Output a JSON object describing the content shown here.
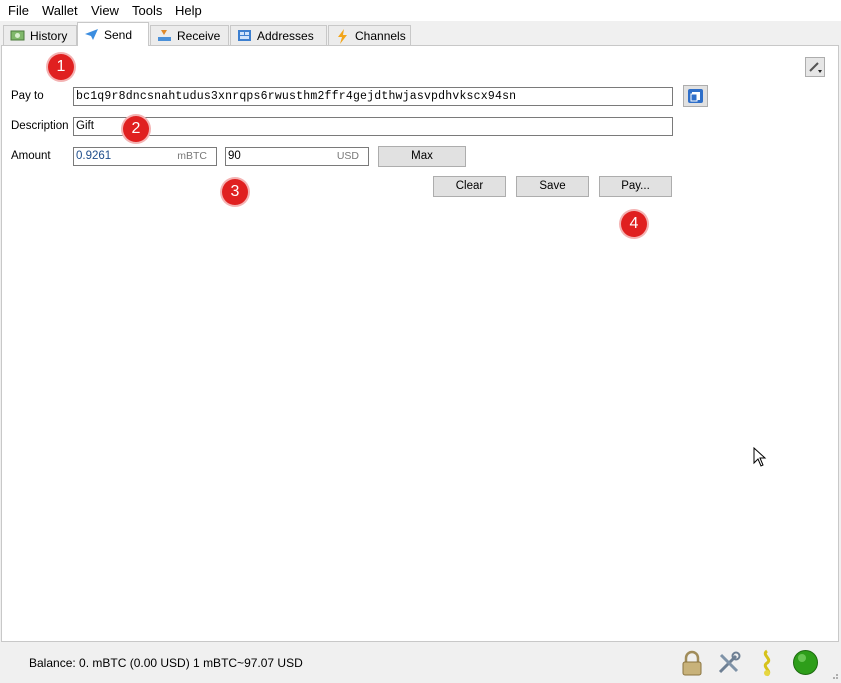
{
  "menu": {
    "file": "File",
    "wallet": "Wallet",
    "view": "View",
    "tools": "Tools",
    "help": "Help"
  },
  "tabs": [
    {
      "label": "History",
      "icon": "history-icon"
    },
    {
      "label": "Send",
      "icon": "send-icon"
    },
    {
      "label": "Receive",
      "icon": "receive-icon"
    },
    {
      "label": "Addresses",
      "icon": "addresses-icon"
    },
    {
      "label": "Channels",
      "icon": "lightning-icon"
    }
  ],
  "form": {
    "pay_to_label": "Pay to",
    "pay_to_value": "bc1q9r8dncsnahtudus3xnrqps6rwusthm2ffr4gejdthwjasvpdhvkscx94sn",
    "description_label": "Description",
    "description_value": "Gift",
    "amount_label": "Amount",
    "amount_btc_value": "0.9261",
    "amount_btc_unit": "mBTC",
    "amount_fiat_value": "90",
    "amount_fiat_unit": "USD"
  },
  "buttons": {
    "max": "Max",
    "clear": "Clear",
    "save": "Save",
    "pay": "Pay..."
  },
  "badges": [
    "1",
    "2",
    "3",
    "4"
  ],
  "status": {
    "balance": "Balance: 0. mBTC (0.00 USD)  1 mBTC~97.07 USD"
  },
  "colors": {
    "badge": "#e02020",
    "amount_text": "#1f4e8c",
    "network_ok": "#2e9e1a"
  }
}
